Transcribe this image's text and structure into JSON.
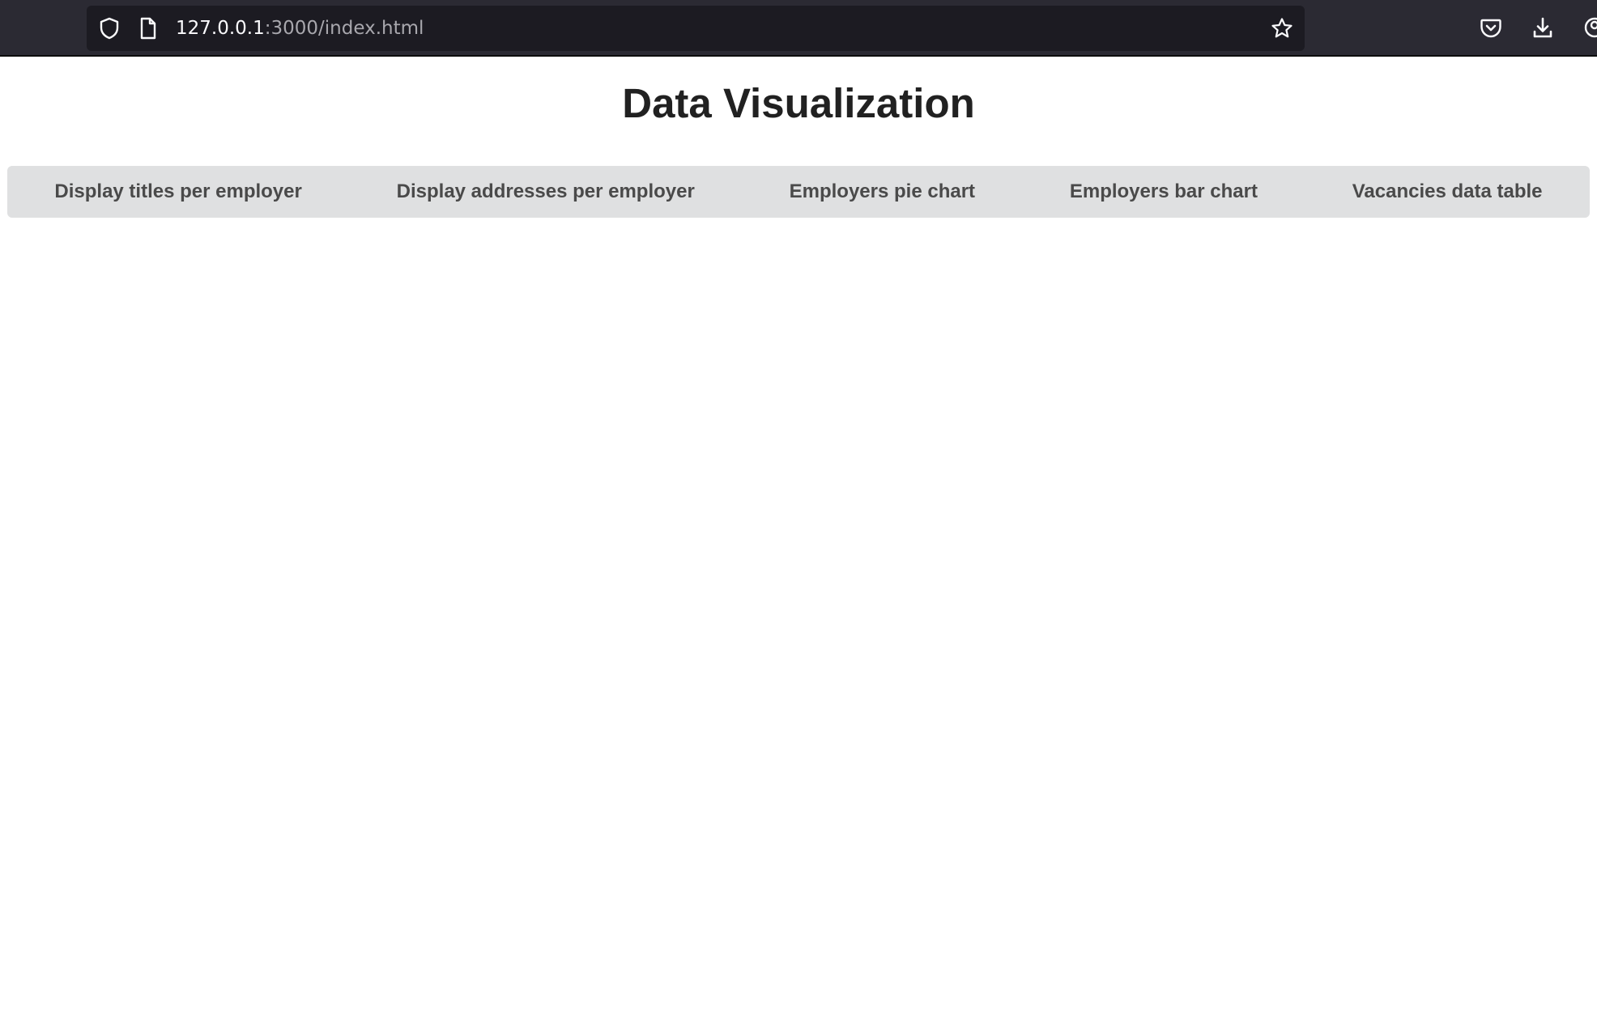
{
  "browser": {
    "url_host": "127.0.0.1",
    "url_path": ":3000/index.html",
    "icons": {
      "shield": "shield-icon",
      "page": "page-icon",
      "star": "star-icon",
      "pocket": "pocket-icon",
      "download": "download-icon",
      "account": "account-icon"
    }
  },
  "page": {
    "title": "Data Visualization",
    "nav": [
      {
        "label": "Display titles per employer"
      },
      {
        "label": "Display addresses per employer"
      },
      {
        "label": "Employers pie chart"
      },
      {
        "label": "Employers bar chart"
      },
      {
        "label": "Vacancies data table"
      }
    ]
  },
  "colors": {
    "chrome_bg": "#2b2a33",
    "urlbar_bg": "#1c1b22",
    "nav_bg": "#dfe0e1",
    "nav_text": "#4a4a4a",
    "title_text": "#212121"
  }
}
